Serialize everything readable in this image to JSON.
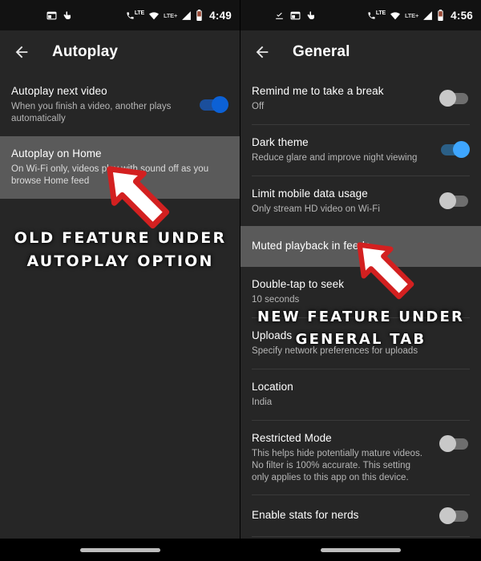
{
  "left_phone": {
    "status_bar": {
      "time": "4:49",
      "icons": [
        "app-window-icon",
        "hand-tap-icon",
        "lte-call-icon",
        "wifi-icon",
        "lte-plus-icon",
        "signal-bars-icon",
        "battery-icon"
      ],
      "network_label": "LTE",
      "network_label_secondary": "LTE+"
    },
    "appbar": {
      "back": "back-arrow-icon",
      "title": "Autoplay"
    },
    "rows": [
      {
        "title": "Autoplay next video",
        "subtitle": "When you finish a video, another plays automatically",
        "toggle": "on",
        "toggle_color": "#0c61d6",
        "highlight": false
      },
      {
        "title": "Autoplay on Home",
        "subtitle": "On Wi-Fi only, videos play with sound off as you browse Home feed",
        "toggle": "none",
        "highlight": true
      }
    ],
    "annotation": "OLD FEATURE UNDER\nAUTOPLAY OPTION"
  },
  "right_phone": {
    "status_bar": {
      "time": "4:56",
      "icons": [
        "download-done-icon",
        "app-window-icon",
        "hand-tap-icon",
        "lte-call-icon",
        "wifi-icon",
        "lte-plus-icon",
        "signal-bars-icon",
        "battery-icon"
      ],
      "network_label": "LTE",
      "network_label_secondary": "LTE+"
    },
    "appbar": {
      "back": "back-arrow-icon",
      "title": "General"
    },
    "rows": [
      {
        "title": "Remind me to take a break",
        "subtitle": "Off",
        "toggle": "off",
        "highlight": false
      },
      {
        "title": "Dark theme",
        "subtitle": "Reduce glare and improve night viewing",
        "toggle": "on",
        "toggle_color": "#3ea6ff",
        "highlight": false
      },
      {
        "title": "Limit mobile data usage",
        "subtitle": "Only stream HD video on Wi-Fi",
        "toggle": "off",
        "highlight": false
      },
      {
        "title": "Muted playback in feeds",
        "subtitle": "",
        "toggle": "none",
        "highlight": true
      },
      {
        "title": "Double-tap to seek",
        "subtitle": "10 seconds",
        "toggle": "none",
        "highlight": false
      },
      {
        "title": "Uploads",
        "subtitle": "Specify network preferences for uploads",
        "toggle": "none",
        "highlight": false
      },
      {
        "title": "Location",
        "subtitle": "India",
        "toggle": "none",
        "highlight": false
      },
      {
        "title": "Restricted Mode",
        "subtitle": "This helps hide potentially mature videos. No filter is 100% accurate. This setting only applies to this app on this device.",
        "toggle": "off",
        "highlight": false
      },
      {
        "title": "Enable stats for nerds",
        "subtitle": "",
        "toggle": "off",
        "highlight": false
      }
    ],
    "annotation": "NEW FEATURE UNDER\nGENERAL TAB"
  },
  "colors": {
    "background": "#262626",
    "status_bar": "#121212",
    "highlight_row": "#5a5a5a",
    "divider": "#3a3a3a",
    "accent_blue_dark": "#0c61d6",
    "accent_blue_light": "#3ea6ff",
    "toggle_off": "#c8c8c8",
    "annotation_arrow": "#d32020",
    "nav_bar": "#000000"
  }
}
